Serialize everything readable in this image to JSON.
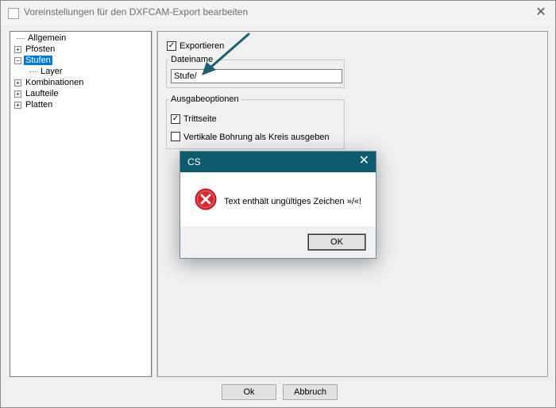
{
  "window": {
    "title": "Voreinstellungen für den DXFCAM-Export bearbeiten",
    "close_glyph": "✕"
  },
  "tree": {
    "items": [
      {
        "label": "Allgemein",
        "expander": ""
      },
      {
        "label": "Pfosten",
        "expander": "+"
      },
      {
        "label": "Stufen",
        "expander": "−"
      },
      {
        "label": "Layer",
        "expander": ""
      },
      {
        "label": "Kombinationen",
        "expander": "+"
      },
      {
        "label": "Laufteile",
        "expander": "+"
      },
      {
        "label": "Platten",
        "expander": "+"
      }
    ],
    "selected": "Stufen"
  },
  "panel": {
    "export_checkbox": {
      "label": "Exportieren",
      "checked": true
    },
    "filename_group": {
      "legend": "Dateiname",
      "value": "Stufe/"
    },
    "output_group": {
      "legend": "Ausgabeoptionen",
      "options": [
        {
          "label": "Trittseite",
          "checked": true
        },
        {
          "label": "Vertikale Bohrung als Kreis ausgeben",
          "checked": false
        }
      ]
    }
  },
  "buttons": {
    "ok": "Ok",
    "cancel": "Abbruch"
  },
  "dialog": {
    "title": "CS",
    "close_glyph": "✕",
    "message": "Text enthält ungültiges Zeichen »/«!",
    "ok": "OK",
    "icon": "error-icon"
  },
  "colors": {
    "dialog_titlebar": "#0b5a6e",
    "selection": "#0078d7",
    "annotation_arrow": "#1d5f73",
    "error_red": "#d9262b"
  },
  "check_glyph": "✓"
}
